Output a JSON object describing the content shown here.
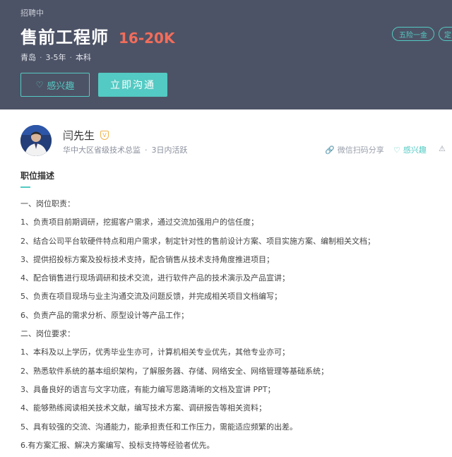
{
  "header": {
    "status": "招聘中",
    "job_title": "售前工程师",
    "salary": "16-20K",
    "location": "青岛",
    "experience": "3-5年",
    "education": "本科",
    "separator": "·",
    "interest_button": "感兴趣",
    "chat_button": "立即沟通",
    "tags": [
      "五险一金",
      "定"
    ]
  },
  "recruiter": {
    "name": "闫先生",
    "title": "华中大区省级技术总监",
    "separator": "·",
    "active": "3日内活跃",
    "share_label": "微信扫码分享",
    "like_label": "感兴趣",
    "report_icon": "warning-icon",
    "verified_mark": "V"
  },
  "description": {
    "heading": "职位描述",
    "lines": [
      "一、岗位职责：",
      "1、负责项目前期调研，挖掘客户需求，通过交流加强用户的信任度；",
      "2、结合公司平台软硬件特点和用户需求，制定针对性的售前设计方案、项目实施方案、编制相关文档；",
      "3、提供招投标方案及投标技术支持，配合销售从技术支持角度推进项目；",
      "4、配合销售进行现场调研和技术交流，进行软件产品的技术演示及产品宣讲；",
      "5、负责在项目现场与业主沟通交流及问题反馈，并完成相关项目文档编写；",
      "6、负责产品的需求分析、原型设计等产品工作；",
      "二、岗位要求：",
      "1、本科及以上学历，优秀毕业生亦可，计算机相关专业优先，其他专业亦可；",
      "2、熟悉软件系统的基本组织架构，了解服务器、存储、网络安全、网络管理等基础系统；",
      "3、具备良好的语言与文字功底，有能力编写思路清晰的文档及宣讲 PPT；",
      "4、能够熟练阅读相关技术文献，编写技术方案、调研报告等相关资料；",
      "5、具有较强的交流、沟通能力，能承担责任和工作压力，需能适应频繁的出差。",
      "6.有方案汇报、解决方案编写、投标支持等经验者优先。"
    ]
  },
  "colors": {
    "header_bg": "#4d5366",
    "accent": "#53cac3",
    "salary": "#f26d5b"
  }
}
